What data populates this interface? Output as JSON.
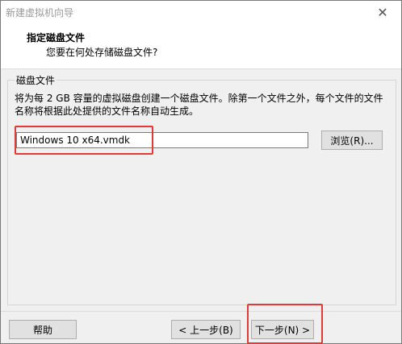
{
  "window": {
    "title": "新建虚拟机向导",
    "close_glyph": "✕"
  },
  "header": {
    "title": "指定磁盘文件",
    "subtitle": "您要在何处存储磁盘文件?"
  },
  "group": {
    "legend": "磁盘文件",
    "description": "将为每 2 GB 容量的虚拟磁盘创建一个磁盘文件。除第一个文件之外，每个文件的文件名称将根据此处提供的文件名称自动生成。",
    "file_value": "Windows 10 x64.vmdk",
    "browse_label": "浏览(R)..."
  },
  "footer": {
    "help_label": "帮助",
    "back_label": "< 上一步(B)",
    "next_label": "下一步(N) >"
  },
  "highlight_color": "#e53935",
  "icons": [
    "close-icon"
  ]
}
